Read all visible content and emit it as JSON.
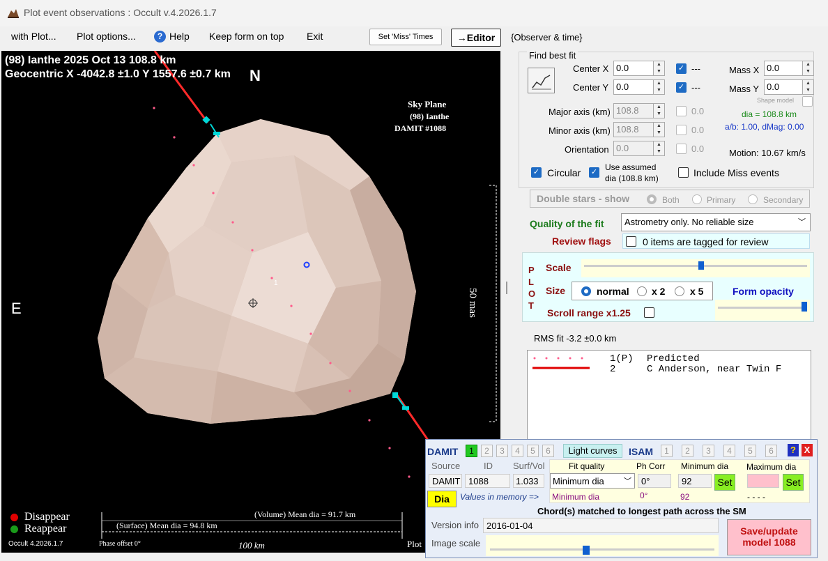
{
  "window": {
    "title": "Plot event observations : Occult v.4.2026.1.7"
  },
  "menu": {
    "with_plot": "with Plot...",
    "plot_options": "Plot options...",
    "help": "Help",
    "keep_on_top": "Keep form on top",
    "exit": "Exit",
    "set_miss": "Set 'Miss' Times",
    "editor": "→Editor",
    "observer_time": "{Observer & time}"
  },
  "plot": {
    "line1": "(98) Ianthe  2025 Oct 13  108.8 km",
    "line2": "Geocentric X -4042.8 ±1.0 Y 1557.6 ±0.7 km",
    "north": "N",
    "east": "E",
    "skyplane1": "Sky Plane",
    "skyplane2": "(98) Ianthe",
    "skyplane3": "DAMIT #1088",
    "scale_label": "50 mas",
    "chord_label": "1",
    "legend_dis": "Disappear",
    "legend_rea": "Reappear",
    "version": "Occult 4.2026.1.7",
    "phase": "Phase offset 0°",
    "vol_mean": "(Volume) Mean dia = 91.7 km",
    "surf_mean": "(Surface) Mean dia = 94.8 km",
    "km100": "100 km",
    "plot_tag": "Plot",
    "colors": {
      "disappear": "#e00000",
      "reappear": "#1a9a1a",
      "chord": "#ff2a2a",
      "cyan": "#00d8d8"
    }
  },
  "fit": {
    "group_label": "Find best fit",
    "center_x_label": "Center X",
    "center_x": "0.0",
    "center_y_label": "Center Y",
    "center_y": "0.0",
    "dash": "---",
    "mass_x_label": "Mass X",
    "mass_x": "0.0",
    "mass_y_label": "Mass Y",
    "mass_y": "0.0",
    "shape_model": "Shape model",
    "major_label": "Major axis (km)",
    "major": "108.8",
    "minor_label": "Minor axis (km)",
    "minor": "108.8",
    "orient_label": "Orientation",
    "orient": "0.0",
    "zero": "0.0",
    "dia_info": "dia = 108.8 km",
    "ab_info": "a/b: 1.00, dMag: 0.00",
    "motion": "Motion: 10.67 km/s",
    "circular": "Circular",
    "use_assumed1": "Use assumed",
    "use_assumed2": "dia (108.8 km)",
    "include_miss": "Include Miss events",
    "double_stars": "Double stars - show",
    "both": "Both",
    "primary": "Primary",
    "secondary": "Secondary",
    "quality_label": "Quality of the fit",
    "quality_value": "Astrometry only. No reliable size",
    "review_label": "Review flags",
    "review_value": "0 items are tagged for review"
  },
  "plotbox": {
    "p": "P",
    "l": "L",
    "o": "O",
    "t": "T",
    "scale": "Scale",
    "size": "Size",
    "normal": "normal",
    "x2": "x 2",
    "x5": "x 5",
    "form_opacity": "Form opacity",
    "scroll": "Scroll range x1.25"
  },
  "rms": "RMS fit -3.2 ±0.0 km",
  "chords": [
    {
      "num": "1(P)",
      "name": "Predicted"
    },
    {
      "num": "2",
      "name": "C Anderson, near Twin F"
    }
  ],
  "damitpanel": {
    "damit": "DAMIT",
    "isam": "ISAM",
    "n1": "1",
    "n2": "2",
    "n3": "3",
    "n4": "4",
    "n5": "5",
    "n6": "6",
    "light_curves": "Light curves",
    "help_q": "?",
    "close_x": "X",
    "source_h": "Source",
    "id_h": "ID",
    "surf_h": "Surf/Vol",
    "source": "DAMIT",
    "id": "1088",
    "surfvol": "1.033",
    "fitq_h": "Fit quality",
    "phcorr_h": "Ph Corr",
    "mindia_h": "Minimum dia",
    "maxdia_h": "Maximum dia",
    "fitq": "Minimum dia",
    "phcorr": "0°",
    "mindia": "92",
    "set": "Set",
    "dia_btn": "Dia",
    "values_mem": "Values in memory =>",
    "mem_fitq": "Minimum dia",
    "mem_ph": "0°",
    "mem_min": "92",
    "mem_max": "- - - -",
    "chord_match": "Chord(s) matched to longest path across the SM",
    "version_label": "Version info",
    "version_value": "2016-01-04",
    "image_scale": "Image scale",
    "save1": "Save/update",
    "save2": "model 1088"
  }
}
